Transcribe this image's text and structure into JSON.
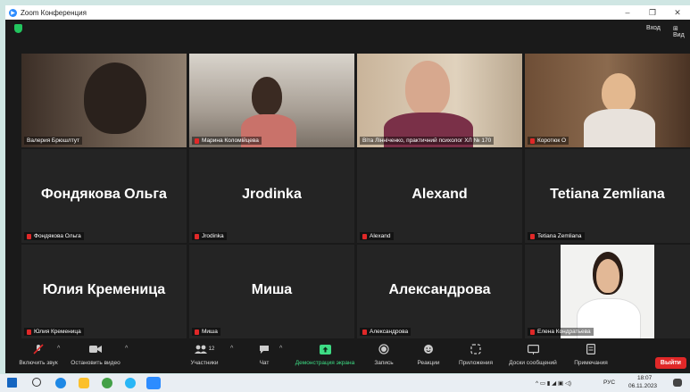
{
  "window": {
    "title": "Zoom Конференция",
    "minimize": "–",
    "maximize": "❐",
    "close": "✕"
  },
  "topbar": {
    "enter": "Вход",
    "view": "Вид"
  },
  "tiles": [
    {
      "label": "Валерия Брюшлтут",
      "name": ""
    },
    {
      "label": "Марина Коломійцева",
      "name": ""
    },
    {
      "label": "Віта Лінніченко, практичний психолог ХЛ № 170",
      "name": ""
    },
    {
      "label": "Коротюк О",
      "name": ""
    },
    {
      "label": "Фондякова Ольга",
      "name": "Фондякова Ольга"
    },
    {
      "label": "Jrodinka",
      "name": "Jrodinka"
    },
    {
      "label": "Alexand",
      "name": "Alexand"
    },
    {
      "label": "Tetiana Zemliana",
      "name": "Tetiana Zemliana"
    },
    {
      "label": "Юлия Кременица",
      "name": "Юлия Кременица"
    },
    {
      "label": "Миша",
      "name": "Миша"
    },
    {
      "label": "Александрова",
      "name": "Александрова"
    },
    {
      "label": "Елена Кондратьева",
      "name": ""
    }
  ],
  "toolbar": {
    "mute": "Включить звук",
    "video": "Остановить видео",
    "participants": "Участники",
    "participants_count": "12",
    "chat": "Чат",
    "share": "Демонстрация экрана",
    "record": "Запись",
    "reactions": "Реакции",
    "apps": "Приложения",
    "whiteboards": "Доски сообщений",
    "notes": "Примечания",
    "leave": "Выйти"
  },
  "taskbar": {
    "lang": "РУС",
    "time": "18:07",
    "date": "06.11.2023"
  },
  "colors": {
    "active_speaker": "#b7d84a",
    "share_green": "#3ddc84",
    "leave_red": "#e02828"
  }
}
